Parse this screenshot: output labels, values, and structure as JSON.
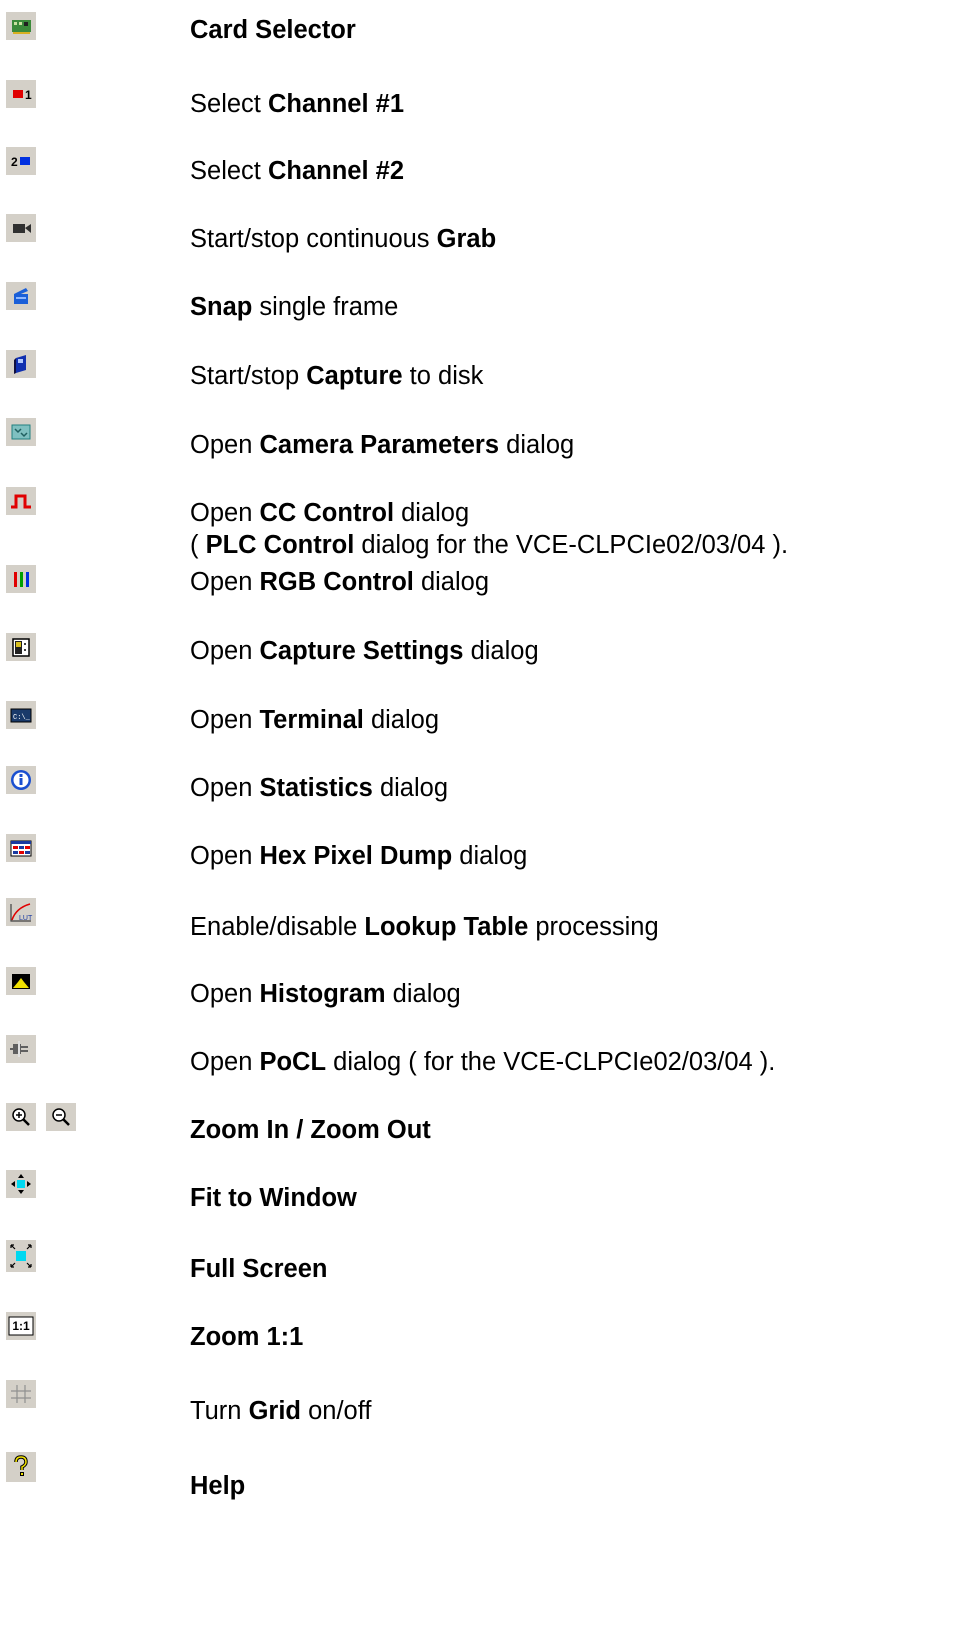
{
  "items": [
    {
      "icon": "card-selector-icon",
      "pre": "",
      "bold": "Card Selector",
      "post": ""
    },
    {
      "icon": "channel-1-icon",
      "pre": "Select ",
      "bold": "Channel #1",
      "post": ""
    },
    {
      "icon": "channel-2-icon",
      "pre": "Select ",
      "bold": "Channel #2",
      "post": ""
    },
    {
      "icon": "grab-camera-icon",
      "pre": "Start/stop continuous ",
      "bold": "Grab",
      "post": ""
    },
    {
      "icon": "snap-icon",
      "pre": "",
      "bold": "Snap",
      "post": " single frame"
    },
    {
      "icon": "capture-icon",
      "pre": "Start/stop ",
      "bold": "Capture",
      "post": " to disk"
    },
    {
      "icon": "camera-parameters-icon",
      "pre": "Open ",
      "bold": "Camera Parameters",
      "post": " dialog"
    },
    {
      "icon": "cc-control-icon",
      "pre": "Open ",
      "bold": "CC Control",
      "post": " dialog",
      "line2_pre": "( ",
      "line2_bold": "PLC Control",
      "line2_post": " dialog for the VCE-CLPCIe02/03/04 )."
    },
    {
      "icon": "rgb-control-icon",
      "pre": "Open ",
      "bold": "RGB Control",
      "post": " dialog"
    },
    {
      "icon": "capture-settings-icon",
      "pre": "Open ",
      "bold": "Capture Settings",
      "post": " dialog"
    },
    {
      "icon": "terminal-icon",
      "pre": "Open ",
      "bold": "Terminal",
      "post": " dialog"
    },
    {
      "icon": "statistics-icon",
      "pre": "Open ",
      "bold": "Statistics",
      "post": " dialog"
    },
    {
      "icon": "hex-pixel-dump-icon",
      "pre": "Open ",
      "bold": "Hex Pixel Dump",
      "post": " dialog"
    },
    {
      "icon": "lookup-table-icon",
      "pre": "Enable/disable ",
      "bold": "Lookup Table",
      "post": " processing"
    },
    {
      "icon": "histogram-icon",
      "pre": "Open ",
      "bold": "Histogram",
      "post": " dialog"
    },
    {
      "icon": "pocl-icon",
      "pre": "Open ",
      "bold": "PoCL",
      "post": " dialog ( for the VCE-CLPCIe02/03/04 )."
    },
    {
      "icon": "zoom-in-icon",
      "icon2": "zoom-out-icon",
      "pre": "",
      "bold": "Zoom In / Zoom Out",
      "post": ""
    },
    {
      "icon": "fit-to-window-icon",
      "pre": "",
      "bold": "Fit to Window",
      "post": ""
    },
    {
      "icon": "full-screen-icon",
      "pre": "",
      "bold": "Full Screen",
      "post": ""
    },
    {
      "icon": "zoom-1-1-icon",
      "pre": "",
      "bold": "Zoom 1:1",
      "post": "",
      "icon_label": "1:1"
    },
    {
      "icon": "grid-icon",
      "pre": "Turn ",
      "bold": "Grid",
      "post": " on/off"
    },
    {
      "icon": "help-icon",
      "pre": "",
      "bold": "Help",
      "post": ""
    }
  ]
}
